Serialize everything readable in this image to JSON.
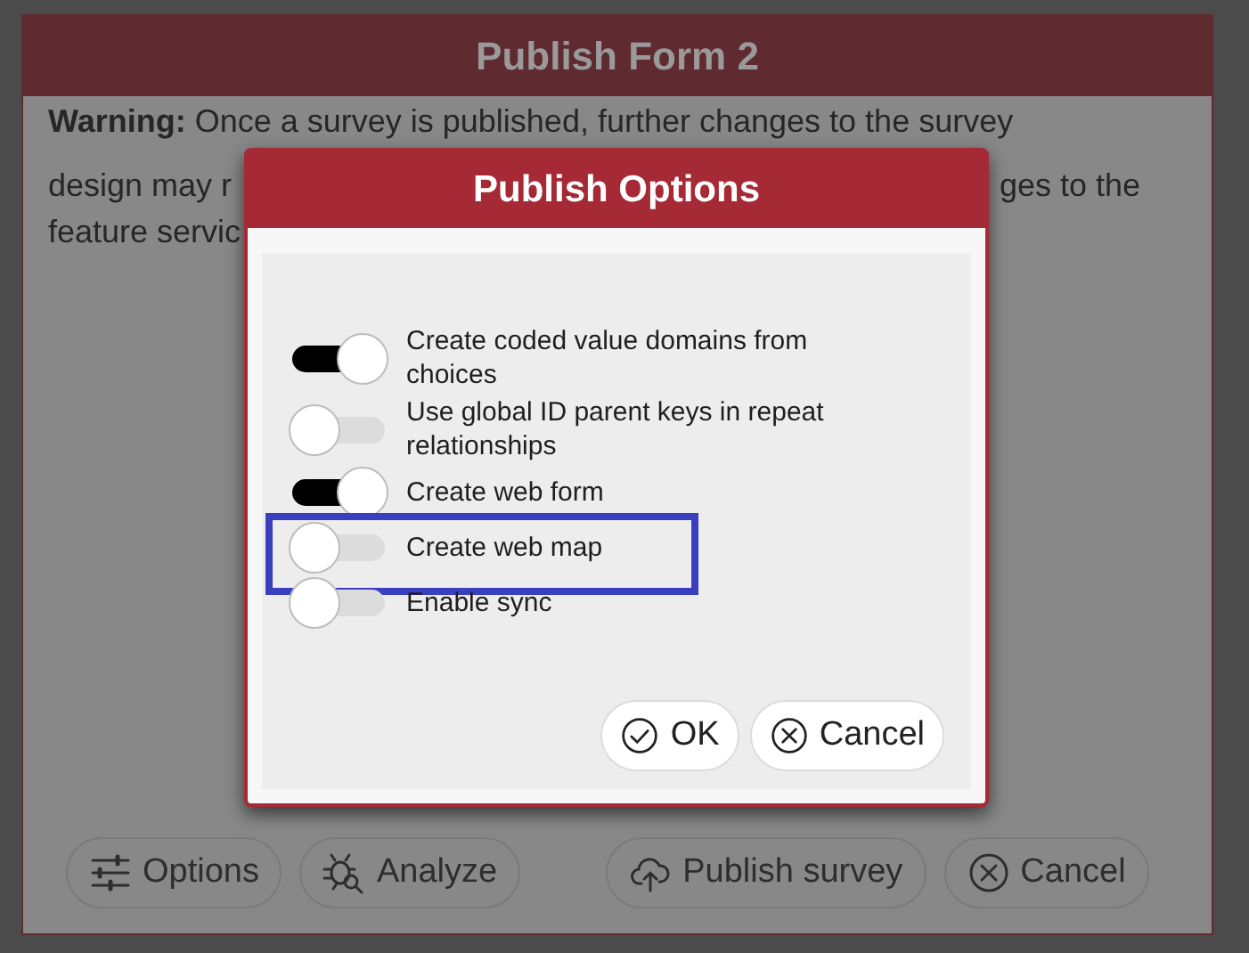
{
  "window": {
    "title": "Publish Form 2"
  },
  "warning": {
    "label": "Warning:",
    "line_1": "Once a survey is published, further changes to the survey",
    "line_2_left": "design may r",
    "line_2_right": "ges to the",
    "line_3": "feature servic"
  },
  "footer_buttons": [
    {
      "label": "Options"
    },
    {
      "label": "Analyze"
    },
    {
      "label": "Publish survey"
    },
    {
      "label": "Cancel"
    }
  ],
  "dialog": {
    "title": "Publish Options",
    "options": [
      {
        "label": "Create coded value domains from choices",
        "on": true
      },
      {
        "label": "Use global ID parent keys in repeat relationships",
        "on": false
      },
      {
        "label": "Create web form",
        "on": true
      },
      {
        "label": "Create web map",
        "on": false,
        "highlighted": true
      },
      {
        "label": "Enable sync",
        "on": false
      }
    ],
    "buttons": [
      {
        "label": "OK"
      },
      {
        "label": "Cancel"
      }
    ]
  }
}
